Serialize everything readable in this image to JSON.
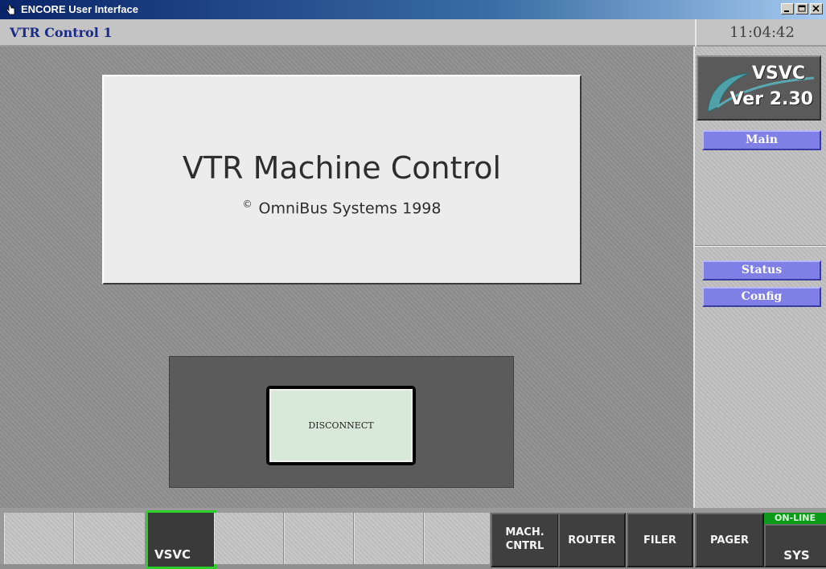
{
  "window": {
    "title": "ENCORE User Interface"
  },
  "header": {
    "screen_title": "VTR Control 1",
    "clock": "11:04:42"
  },
  "splash": {
    "title": "VTR Machine Control",
    "copyright_symbol": "©",
    "copyright": "OmniBus Systems 1998"
  },
  "connection": {
    "disconnect_label": "DISCONNECT"
  },
  "logo": {
    "name": "VSVC",
    "version": "Ver 2.30"
  },
  "sidebar": {
    "main_label": "Main",
    "status_label": "Status",
    "config_label": "Config"
  },
  "bottom_bar": {
    "vsvc_label": "VSVC",
    "mach_line1": "MACH.",
    "mach_line2": "CNTRL",
    "router_label": "ROUTER",
    "filer_label": "FILER",
    "pager_label": "PAGER",
    "online_label": "ON-LINE",
    "sys_label": "SYS"
  },
  "colors": {
    "accent_green": "#2bd02b",
    "nav_button": "#7f7fe6",
    "title_bar": "#0a246a"
  }
}
